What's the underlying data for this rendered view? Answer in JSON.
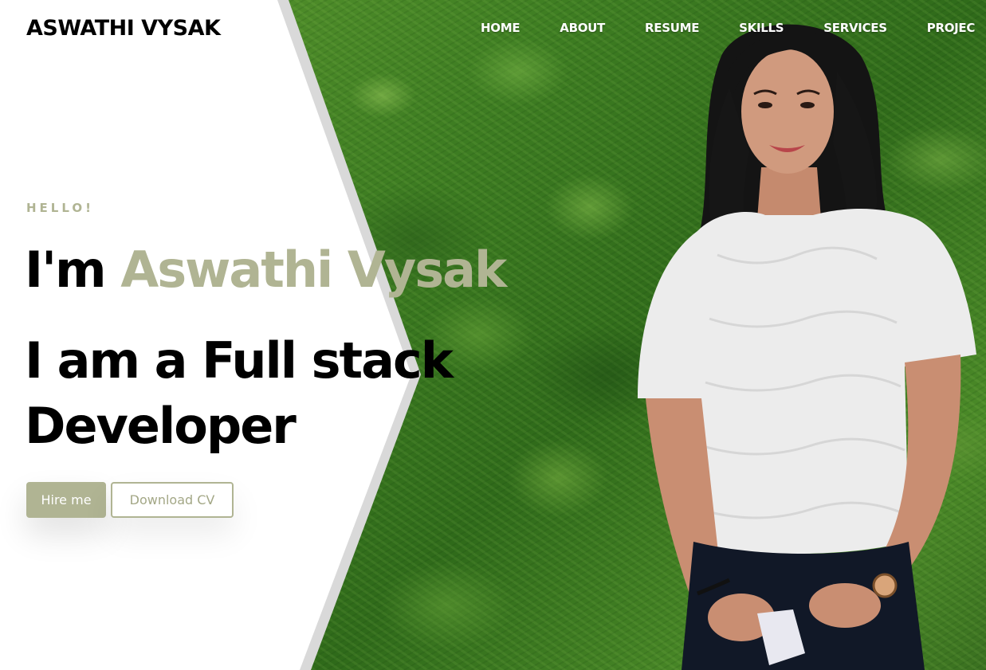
{
  "header": {
    "brand": "ASWATHI VYSAK",
    "nav": [
      "HOME",
      "ABOUT",
      "RESUME",
      "SKILLS",
      "SERVICES",
      "PROJEC"
    ]
  },
  "hero": {
    "greeting": "HELLO!",
    "intro": "I'm",
    "name": "Aswathi Vysak",
    "role": "I am a Full stack Developer",
    "hire_button": "Hire me",
    "download_button": "Download CV"
  },
  "colors": {
    "accent": "#b0b493",
    "text": "#000000",
    "panel": "#ffffff",
    "foliage": "#3e7d22"
  },
  "images": {
    "hero_photo": "portrait-photo"
  }
}
